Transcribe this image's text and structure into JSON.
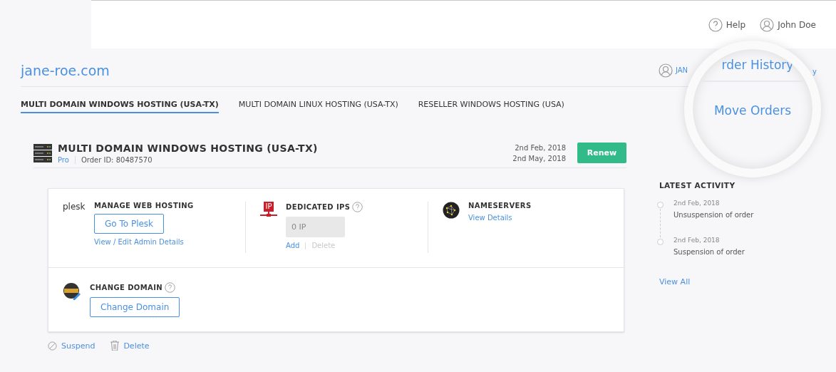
{
  "header": {
    "help": "Help",
    "user": "John Doe"
  },
  "domain": {
    "title": "jane-roe.com",
    "account_link": "JAN",
    "right_link": "y"
  },
  "magnifier": {
    "items": [
      "rder History",
      "Move Orders"
    ]
  },
  "tabs": [
    {
      "label": "MULTI DOMAIN WINDOWS HOSTING (USA-TX)",
      "selected": true
    },
    {
      "label": "MULTI DOMAIN LINUX HOSTING (USA-TX)",
      "selected": false
    },
    {
      "label": "RESELLER WINDOWS HOSTING (USA)",
      "selected": false
    }
  ],
  "order": {
    "title": "MULTI DOMAIN WINDOWS HOSTING (USA-TX)",
    "plan": "Pro",
    "order_id": "Order ID: 80487570",
    "dates": [
      "2nd Feb, 2018",
      "2nd May, 2018"
    ],
    "renew": "Renew"
  },
  "sections": [
    {
      "kind": "plesk",
      "logo": "plesk",
      "title": "MANAGE WEB HOSTING",
      "button": "Go To Plesk",
      "link": "View / Edit Admin Details"
    },
    {
      "kind": "ips",
      "logo": "IP",
      "title": "DEDICATED IPS",
      "help": true,
      "field": "0 IP",
      "actions": [
        {
          "label": "Add",
          "disabled": false
        },
        {
          "label": "Delete",
          "disabled": true
        }
      ]
    },
    {
      "kind": "nameservers",
      "title": "NAMESERVERS",
      "link": "View Details"
    }
  ],
  "change_domain": {
    "title": "CHANGE DOMAIN",
    "help": true,
    "button": "Change Domain"
  },
  "footer_actions": [
    {
      "kind": "suspend",
      "label": "Suspend"
    },
    {
      "kind": "delete",
      "label": "Delete"
    }
  ],
  "activity": {
    "title": "LATEST ACTIVITY",
    "items": [
      {
        "date": "2nd Feb, 2018",
        "text": "Unsuspension of order"
      },
      {
        "date": "2nd Feb, 2018",
        "text": "Suspension of order"
      }
    ],
    "view_all": "View All"
  }
}
